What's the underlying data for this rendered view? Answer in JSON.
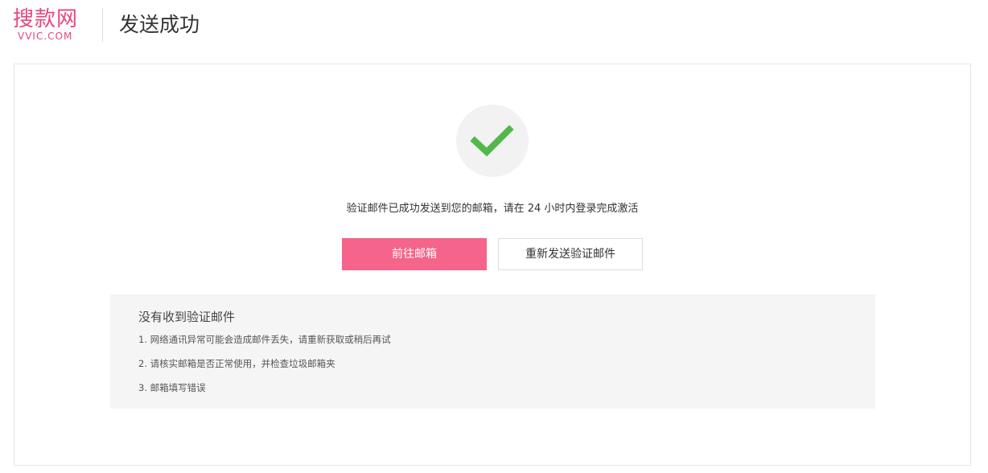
{
  "header": {
    "logo_main": "搜款网",
    "logo_sub": "VVIC.COM",
    "title": "发送成功"
  },
  "status": {
    "icon": "check-icon",
    "icon_color": "#52b84a",
    "circle_color": "#f2f2f2",
    "message": "验证邮件已成功发送到您的邮箱，请在 24 小时内登录完成激活"
  },
  "actions": {
    "go_to_mailbox": "前往邮箱",
    "resend": "重新发送验证邮件",
    "primary_color": "#f5648a"
  },
  "help": {
    "title": "没有收到验证邮件",
    "items": [
      "1. 网络通讯异常可能会造成邮件丢失，请重新获取或稍后再试",
      "2. 请核实邮箱是否正常使用，并检查垃圾邮箱夹",
      "3. 邮箱填写错误"
    ]
  },
  "brand": {
    "accent": "#e9467a"
  }
}
